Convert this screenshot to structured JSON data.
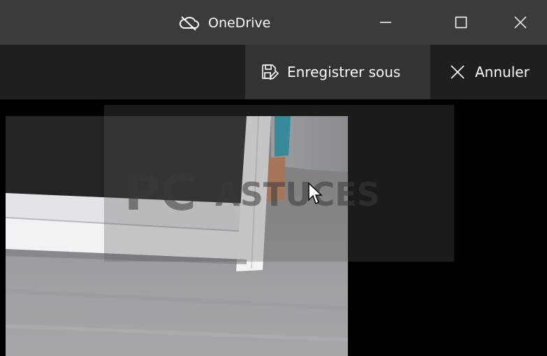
{
  "window": {
    "title": "OneDrive",
    "title_icon": "cloud-off-icon",
    "controls": {
      "minimize_icon": "minimize-icon",
      "maximize_icon": "maximize-icon",
      "close_icon": "close-icon"
    }
  },
  "commandbar": {
    "save_as_label": "Enregistrer sous",
    "save_as_icon": "save-as-icon",
    "cancel_label": "Annuler",
    "cancel_icon": "close-icon"
  },
  "colors": {
    "titlebar_bg": "#3b3b3b",
    "commandbar_bg": "#1f1f1f",
    "highlighted_button_bg": "#333333",
    "canvas_bg": "#000000",
    "text": "#ffffff"
  },
  "watermark": {
    "text": "PC ASTUCES"
  }
}
